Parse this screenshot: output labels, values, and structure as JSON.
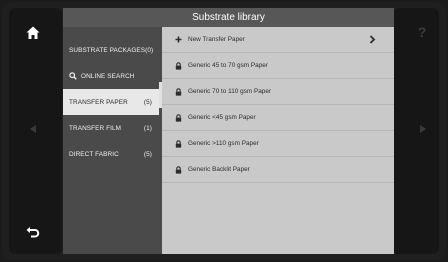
{
  "title": "Substrate library",
  "sidebar": {
    "items": [
      {
        "label": "SUBSTRATE PACKAGES",
        "count": "(0)"
      },
      {
        "label": "ONLINE SEARCH",
        "count": ""
      },
      {
        "label": "TRANSFER PAPER",
        "count": "(5)"
      },
      {
        "label": "TRANSFER FILM",
        "count": "(1)"
      },
      {
        "label": "DIRECT FABRIC",
        "count": "(5)"
      }
    ],
    "selected": "TRANSFER PAPER"
  },
  "list": {
    "add_item": "New Transfer Paper",
    "items": [
      "Generic 45 to 70 gsm Paper",
      "Generic 70 to 110 gsm Paper",
      "Generic <45 gsm Paper",
      "Generic >110 gsm Paper",
      "Generic Backlit Paper"
    ]
  },
  "rail": {
    "help_label": "?"
  },
  "icons": {
    "home": "home-icon",
    "back": "back-arrow-icon",
    "prev": "prev-arrow-icon",
    "next": "next-arrow-icon",
    "search": "search-icon",
    "plus": "plus-icon",
    "lock": "lock-icon",
    "chevron": "chevron-right-icon"
  },
  "colors": {
    "title_bar": "#575757",
    "sidebar": "#4a4a4a",
    "content": "#c9c9c9",
    "selected_item": "#e8e8e8"
  }
}
